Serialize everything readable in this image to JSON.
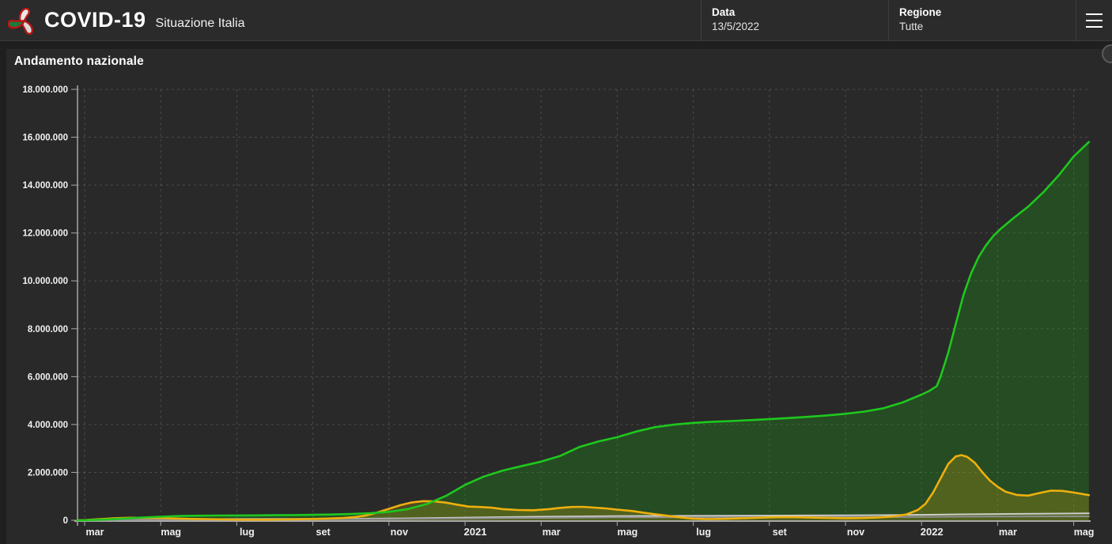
{
  "header": {
    "title": "COVID-19",
    "subtitle": "Situazione Italia",
    "logo": "protezione-civile-logo",
    "date": {
      "label": "Data",
      "value": "13/5/2022"
    },
    "region": {
      "label": "Regione",
      "value": "Tutte"
    },
    "menu_icon": "hamburger-menu-icon"
  },
  "panel": {
    "title": "Andamento nazionale"
  },
  "colors": {
    "green_line": "#1ec81e",
    "green_fill": "rgba(34,160,24,0.30)",
    "yellow_line": "#eeb00d",
    "yellow_fill": "rgba(238,176,13,0.22)",
    "gray_line": "#8f8f8f",
    "light_gray_line": "#cdcdcd",
    "grid": "rgba(255,255,255,0.16)",
    "axis": "#a8a8a8",
    "header_bg": "#2b2b2b",
    "panel_bg": "#292929"
  },
  "chart_data": {
    "type": "area",
    "title": "Andamento nazionale",
    "x_unit": "months since 2020-03-01",
    "xlim": [
      -0.19,
      26.4
    ],
    "ylim": [
      0,
      18000000
    ],
    "grid": "dashed",
    "legend": "none",
    "y_ticks": [
      {
        "value": 0,
        "label": "0"
      },
      {
        "value": 2000000,
        "label": "2.000.000"
      },
      {
        "value": 4000000,
        "label": "4.000.000"
      },
      {
        "value": 6000000,
        "label": "6.000.000"
      },
      {
        "value": 8000000,
        "label": "8.000.000"
      },
      {
        "value": 10000000,
        "label": "10.000.000"
      },
      {
        "value": 12000000,
        "label": "12.000.000"
      },
      {
        "value": 14000000,
        "label": "14.000.000"
      },
      {
        "value": 16000000,
        "label": "16.000.000"
      },
      {
        "value": 18000000,
        "label": "18.000.000"
      }
    ],
    "x_ticks": [
      {
        "m": 0,
        "label": "mar",
        "bold": false
      },
      {
        "m": 2,
        "label": "mag",
        "bold": false
      },
      {
        "m": 4,
        "label": "lug",
        "bold": false
      },
      {
        "m": 6,
        "label": "set",
        "bold": false
      },
      {
        "m": 8,
        "label": "nov",
        "bold": false
      },
      {
        "m": 10,
        "label": "2021",
        "bold": true
      },
      {
        "m": 12,
        "label": "mar",
        "bold": false
      },
      {
        "m": 14,
        "label": "mag",
        "bold": false
      },
      {
        "m": 16,
        "label": "lug",
        "bold": false
      },
      {
        "m": 18,
        "label": "set",
        "bold": false
      },
      {
        "m": 20,
        "label": "nov",
        "bold": false
      },
      {
        "m": 22,
        "label": "2022",
        "bold": true
      },
      {
        "m": 24,
        "label": "mar",
        "bold": false
      },
      {
        "m": 26,
        "label": "mag",
        "bold": false
      }
    ],
    "series": [
      {
        "name": "serie-verde",
        "color_key": "green_line",
        "fill_key": "green_fill",
        "width": 2.6,
        "points": [
          [
            -0.19,
            1000
          ],
          [
            0,
            3000
          ],
          [
            0.5,
            30000
          ],
          [
            1,
            70000
          ],
          [
            1.5,
            115000
          ],
          [
            2,
            150000
          ],
          [
            2.5,
            178000
          ],
          [
            3,
            192000
          ],
          [
            3.5,
            197000
          ],
          [
            4,
            200000
          ],
          [
            4.5,
            205000
          ],
          [
            5,
            211000
          ],
          [
            5.5,
            218000
          ],
          [
            6,
            227000
          ],
          [
            6.5,
            240000
          ],
          [
            7,
            262000
          ],
          [
            7.5,
            298000
          ],
          [
            8,
            355000
          ],
          [
            8.5,
            470000
          ],
          [
            9,
            680000
          ],
          [
            9.5,
            1020000
          ],
          [
            10,
            1480000
          ],
          [
            10.5,
            1830000
          ],
          [
            11,
            2080000
          ],
          [
            11.5,
            2270000
          ],
          [
            12,
            2450000
          ],
          [
            12.5,
            2690000
          ],
          [
            13,
            3060000
          ],
          [
            13.5,
            3290000
          ],
          [
            14,
            3470000
          ],
          [
            14.5,
            3710000
          ],
          [
            15,
            3890000
          ],
          [
            15.5,
            4000000
          ],
          [
            16,
            4070000
          ],
          [
            16.5,
            4115000
          ],
          [
            17,
            4145000
          ],
          [
            17.5,
            4185000
          ],
          [
            18,
            4225000
          ],
          [
            18.5,
            4270000
          ],
          [
            19,
            4320000
          ],
          [
            19.5,
            4380000
          ],
          [
            20,
            4450000
          ],
          [
            20.5,
            4540000
          ],
          [
            21,
            4680000
          ],
          [
            21.5,
            4920000
          ],
          [
            22,
            5250000
          ],
          [
            22.2,
            5400000
          ],
          [
            22.4,
            5600000
          ],
          [
            22.5,
            6000000
          ],
          [
            22.7,
            7000000
          ],
          [
            22.9,
            8200000
          ],
          [
            23.1,
            9400000
          ],
          [
            23.3,
            10300000
          ],
          [
            23.5,
            11000000
          ],
          [
            23.7,
            11500000
          ],
          [
            23.9,
            11900000
          ],
          [
            24.1,
            12200000
          ],
          [
            24.4,
            12600000
          ],
          [
            24.8,
            13100000
          ],
          [
            25.2,
            13700000
          ],
          [
            25.6,
            14400000
          ],
          [
            26,
            15200000
          ],
          [
            26.4,
            15800000
          ]
        ]
      },
      {
        "name": "serie-gialla",
        "color_key": "yellow_line",
        "fill_key": "yellow_fill",
        "width": 2.6,
        "points": [
          [
            -0.19,
            1000
          ],
          [
            0,
            8000
          ],
          [
            0.4,
            45000
          ],
          [
            0.8,
            85000
          ],
          [
            1.2,
            107000
          ],
          [
            1.6,
            103000
          ],
          [
            2,
            95000
          ],
          [
            2.4,
            73000
          ],
          [
            2.8,
            57000
          ],
          [
            3.2,
            48000
          ],
          [
            3.6,
            38000
          ],
          [
            4,
            27000
          ],
          [
            4.4,
            24000
          ],
          [
            4.8,
            27000
          ],
          [
            5.2,
            33000
          ],
          [
            5.6,
            44000
          ],
          [
            6,
            56000
          ],
          [
            6.4,
            73000
          ],
          [
            6.8,
            95000
          ],
          [
            7.1,
            135000
          ],
          [
            7.4,
            200000
          ],
          [
            7.7,
            330000
          ],
          [
            8,
            480000
          ],
          [
            8.3,
            630000
          ],
          [
            8.6,
            745000
          ],
          [
            8.9,
            800000
          ],
          [
            9.2,
            788000
          ],
          [
            9.5,
            735000
          ],
          [
            9.8,
            650000
          ],
          [
            10.1,
            572000
          ],
          [
            10.4,
            555000
          ],
          [
            10.7,
            525000
          ],
          [
            11,
            465000
          ],
          [
            11.4,
            428000
          ],
          [
            11.8,
            418000
          ],
          [
            12.2,
            465000
          ],
          [
            12.5,
            520000
          ],
          [
            12.8,
            555000
          ],
          [
            13.1,
            560000
          ],
          [
            13.4,
            530000
          ],
          [
            13.7,
            495000
          ],
          [
            14,
            445000
          ],
          [
            14.4,
            385000
          ],
          [
            14.8,
            295000
          ],
          [
            15.2,
            210000
          ],
          [
            15.6,
            130000
          ],
          [
            16,
            65000
          ],
          [
            16.4,
            48000
          ],
          [
            16.8,
            58000
          ],
          [
            17.2,
            78000
          ],
          [
            17.6,
            98000
          ],
          [
            18,
            122000
          ],
          [
            18.4,
            136000
          ],
          [
            18.8,
            127000
          ],
          [
            19.2,
            110000
          ],
          [
            19.6,
            96000
          ],
          [
            20,
            87000
          ],
          [
            20.4,
            92000
          ],
          [
            20.8,
            112000
          ],
          [
            21.2,
            150000
          ],
          [
            21.6,
            245000
          ],
          [
            21.9,
            430000
          ],
          [
            22.1,
            680000
          ],
          [
            22.3,
            1150000
          ],
          [
            22.5,
            1750000
          ],
          [
            22.7,
            2350000
          ],
          [
            22.9,
            2670000
          ],
          [
            23.05,
            2720000
          ],
          [
            23.2,
            2650000
          ],
          [
            23.4,
            2400000
          ],
          [
            23.6,
            2000000
          ],
          [
            23.8,
            1650000
          ],
          [
            24,
            1400000
          ],
          [
            24.2,
            1200000
          ],
          [
            24.5,
            1060000
          ],
          [
            24.8,
            1030000
          ],
          [
            25.1,
            1140000
          ],
          [
            25.4,
            1240000
          ],
          [
            25.7,
            1230000
          ],
          [
            26,
            1160000
          ],
          [
            26.4,
            1050000
          ]
        ]
      },
      {
        "name": "serie-grigio-chiara",
        "color_key": "light_gray_line",
        "fill_key": null,
        "width": 2,
        "points": [
          [
            -0.19,
            0
          ],
          [
            0,
            3000
          ],
          [
            0.5,
            15000
          ],
          [
            1,
            32000
          ],
          [
            1.5,
            42000
          ],
          [
            2,
            47000
          ],
          [
            3,
            51000
          ],
          [
            4,
            53000
          ],
          [
            5,
            55000
          ],
          [
            6,
            58000
          ],
          [
            7,
            64000
          ],
          [
            8,
            74000
          ],
          [
            9,
            92000
          ],
          [
            10,
            112000
          ],
          [
            11,
            133000
          ],
          [
            12,
            148000
          ],
          [
            13,
            162000
          ],
          [
            14,
            172000
          ],
          [
            15,
            180000
          ],
          [
            16,
            186000
          ],
          [
            17,
            190000
          ],
          [
            18,
            196000
          ],
          [
            19,
            202000
          ],
          [
            20,
            208000
          ],
          [
            21,
            216000
          ],
          [
            22,
            228000
          ],
          [
            23,
            248000
          ],
          [
            24,
            262000
          ],
          [
            25,
            273000
          ],
          [
            26.4,
            287000
          ]
        ]
      },
      {
        "name": "serie-grigia",
        "color_key": "gray_line",
        "fill_key": null,
        "width": 2,
        "points": [
          [
            -0.19,
            0
          ],
          [
            0,
            2000
          ],
          [
            0.5,
            10000
          ],
          [
            1,
            22000
          ],
          [
            1.5,
            29000
          ],
          [
            2,
            32000
          ],
          [
            3,
            34500
          ],
          [
            4,
            35200
          ],
          [
            5,
            35600
          ],
          [
            6,
            36100
          ],
          [
            7,
            38500
          ],
          [
            8,
            46000
          ],
          [
            9,
            63000
          ],
          [
            10,
            76000
          ],
          [
            11,
            90000
          ],
          [
            12,
            99000
          ],
          [
            13,
            111000
          ],
          [
            14,
            121000
          ],
          [
            15,
            126500
          ],
          [
            16,
            127800
          ],
          [
            17,
            128900
          ],
          [
            18,
            130200
          ],
          [
            19,
            131600
          ],
          [
            20,
            132800
          ],
          [
            21,
            134500
          ],
          [
            22,
            138000
          ],
          [
            23,
            148000
          ],
          [
            24,
            156000
          ],
          [
            25,
            161000
          ],
          [
            26.4,
            165500
          ]
        ]
      }
    ]
  }
}
